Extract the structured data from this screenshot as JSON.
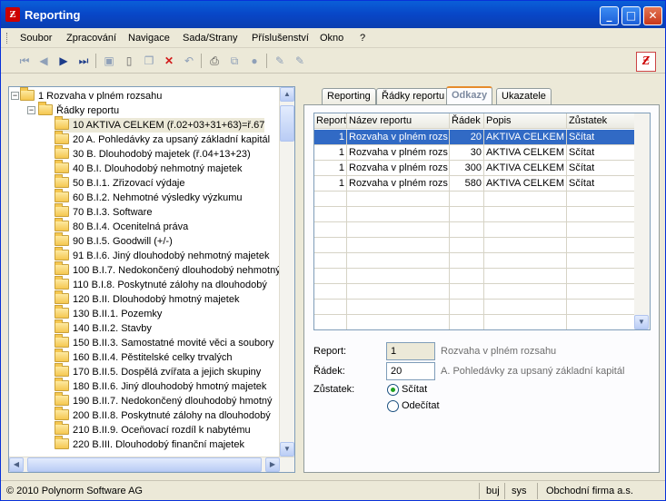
{
  "window": {
    "title": "Reporting",
    "app_icon_text": "Ƶ"
  },
  "menu": [
    "Soubor",
    "Zpracování",
    "Navigace",
    "Sada/Strany",
    "Příslušenství",
    "Okno",
    "?"
  ],
  "toolbar": {
    "icons": [
      "first-icon",
      "prev-icon",
      "next-icon",
      "last-icon",
      "save-icon",
      "new-icon",
      "copy-icon",
      "delete-icon",
      "undo-icon",
      "print-icon",
      "export-icon",
      "refresh-icon",
      "edit-icon",
      "edit2-icon"
    ]
  },
  "tree": {
    "root": "1 Rozvaha v plném rozsahu",
    "group": "Řádky reportu",
    "items": [
      "10 AKTIVA CELKEM (ř.02+03+31+63)=ř.67",
      "20 A. Pohledávky za upsaný základní kapitál",
      "30 B. Dlouhodobý majetek (ř.04+13+23)",
      "40 B.I. Dlouhodobý nehmotný majetek",
      "50 B.I.1. Zřizovací výdaje",
      "60 B.I.2. Nehmotné výsledky výzkumu",
      "70 B.I.3. Software",
      "80 B.I.4. Ocenitelná práva",
      "90 B.I.5. Goodwill (+/-)",
      "91 B.I.6. Jiný dlouhodobý nehmotný majetek",
      "100 B.I.7. Nedokončený dlouhodobý nehmotný",
      "110 B.I.8. Poskytnuté zálohy na dlouhodobý",
      "120 B.II. Dlouhodobý hmotný majetek",
      "130 B.II.1. Pozemky",
      "140 B.II.2. Stavby",
      "150 B.II.3. Samostatné movité věci a soubory",
      "160 B.II.4. Pěstitelské celky trvalých",
      "170 B.II.5. Dospělá zvířata a jejich skupiny",
      "180 B.II.6. Jiný dlouhodobý hmotný majetek",
      "190 B.II.7. Nedokončený dlouhodobý hmotný",
      "200 B.II.8. Poskytnuté zálohy na dlouhodobý",
      "210 B.II.9. Oceňovací rozdíl k nabytému",
      "220 B.III. Dlouhodobý finanční majetek"
    ]
  },
  "tabs": [
    "Reporting",
    "Řádky reportu",
    "Odkazy",
    "Ukazatele"
  ],
  "active_tab": "Odkazy",
  "grid": {
    "columns": [
      "Report",
      "Název reportu",
      "Řádek",
      "Popis",
      "Zůstatek"
    ],
    "rows": [
      [
        "1",
        "Rozvaha v plném rozs",
        "20",
        "AKTIVA CELKEM (",
        "Sčítat"
      ],
      [
        "1",
        "Rozvaha v plném rozs",
        "30",
        "AKTIVA CELKEM (",
        "Sčítat"
      ],
      [
        "1",
        "Rozvaha v plném rozs",
        "300",
        "AKTIVA CELKEM (",
        "Sčítat"
      ],
      [
        "1",
        "Rozvaha v plném rozs",
        "580",
        "AKTIVA CELKEM (",
        "Sčítat"
      ]
    ]
  },
  "form": {
    "report_label": "Report:",
    "report_value": "1",
    "report_desc": "Rozvaha v plném rozsahu",
    "radek_label": "Řádek:",
    "radek_value": "20",
    "radek_desc": "A. Pohledávky za upsaný základní kapitál",
    "zustatek_label": "Zůstatek:",
    "option_scitat": "Sčítat",
    "option_odecitat": "Odečítat",
    "selected_option": "Sčítat"
  },
  "status": {
    "copyright": "© 2010 Polynorm Software AG",
    "user1": "buj",
    "user2": "sys",
    "company": "Obchodní firma a.s."
  },
  "colors": {
    "titlebar": "#0846c7",
    "selection": "#316ac5",
    "active_tab_accent": "#e68b2c"
  }
}
